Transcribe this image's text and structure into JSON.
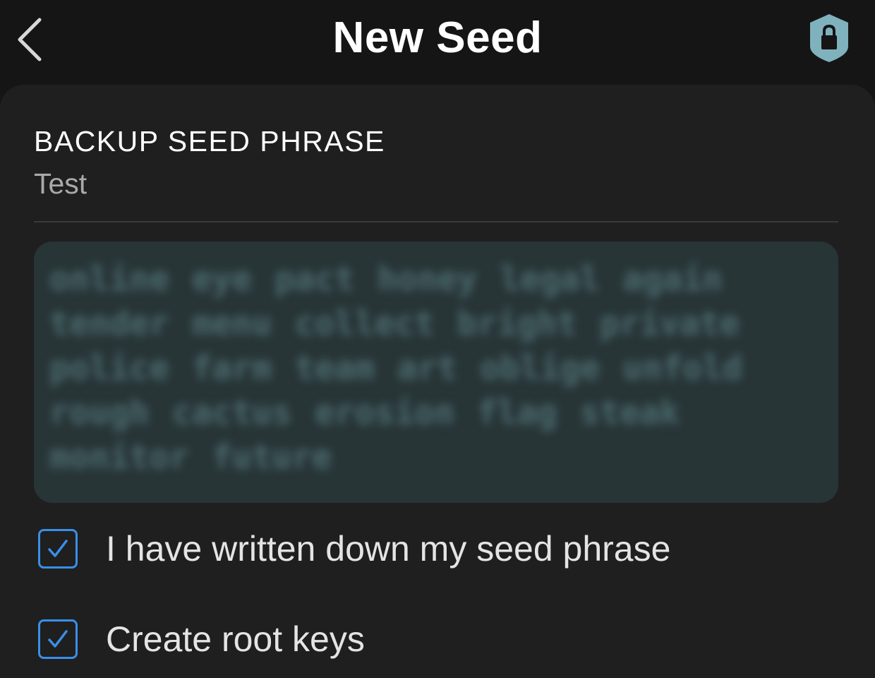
{
  "header": {
    "title": "New Seed",
    "back_icon": "chevron-left-icon",
    "lock_icon": "shield-lock-icon",
    "lock_color": "#7fb2bd"
  },
  "backup": {
    "label": "BACKUP SEED PHRASE",
    "seed_name": "Test",
    "phrase": "online eye pact honey legal again tender menu collect bright private police farm team art oblige unfold rough cactus erosion flag steak monitor future",
    "blurred": true
  },
  "checks": [
    {
      "label": "I have written down my seed phrase",
      "checked": true
    },
    {
      "label": "Create root keys",
      "checked": true
    }
  ],
  "colors": {
    "accent": "#3b8ee8",
    "background": "#151515",
    "card": "#1f1f1f",
    "seed_box": "#283537"
  }
}
